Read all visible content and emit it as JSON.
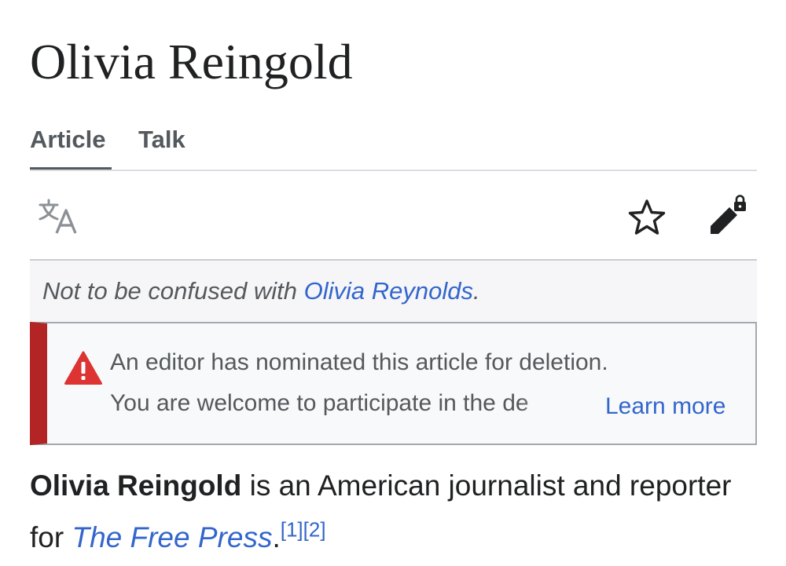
{
  "page": {
    "title": "Olivia Reingold"
  },
  "tabs": [
    {
      "label": "Article",
      "selected": true
    },
    {
      "label": "Talk",
      "selected": false
    }
  ],
  "toolbar": {
    "language_icon": "language-icon",
    "watch_icon": "star-icon",
    "edit_icon": "edit-protected-icon"
  },
  "hatnote": {
    "prefix": "Not to be confused with ",
    "link": "Olivia Reynolds",
    "suffix": "."
  },
  "notice": {
    "icon": "warning-icon",
    "line1": "An editor has nominated this article for deletion.",
    "line2": "You are welcome to participate in the de",
    "learn_more": "Learn more",
    "accent_color": "#b32424"
  },
  "lead": {
    "subject": "Olivia Reingold",
    "text1": " is an American journalist and reporter for ",
    "publication": "The Free Press",
    "text2": ".",
    "ref1": "[1]",
    "ref2": "[2]"
  }
}
